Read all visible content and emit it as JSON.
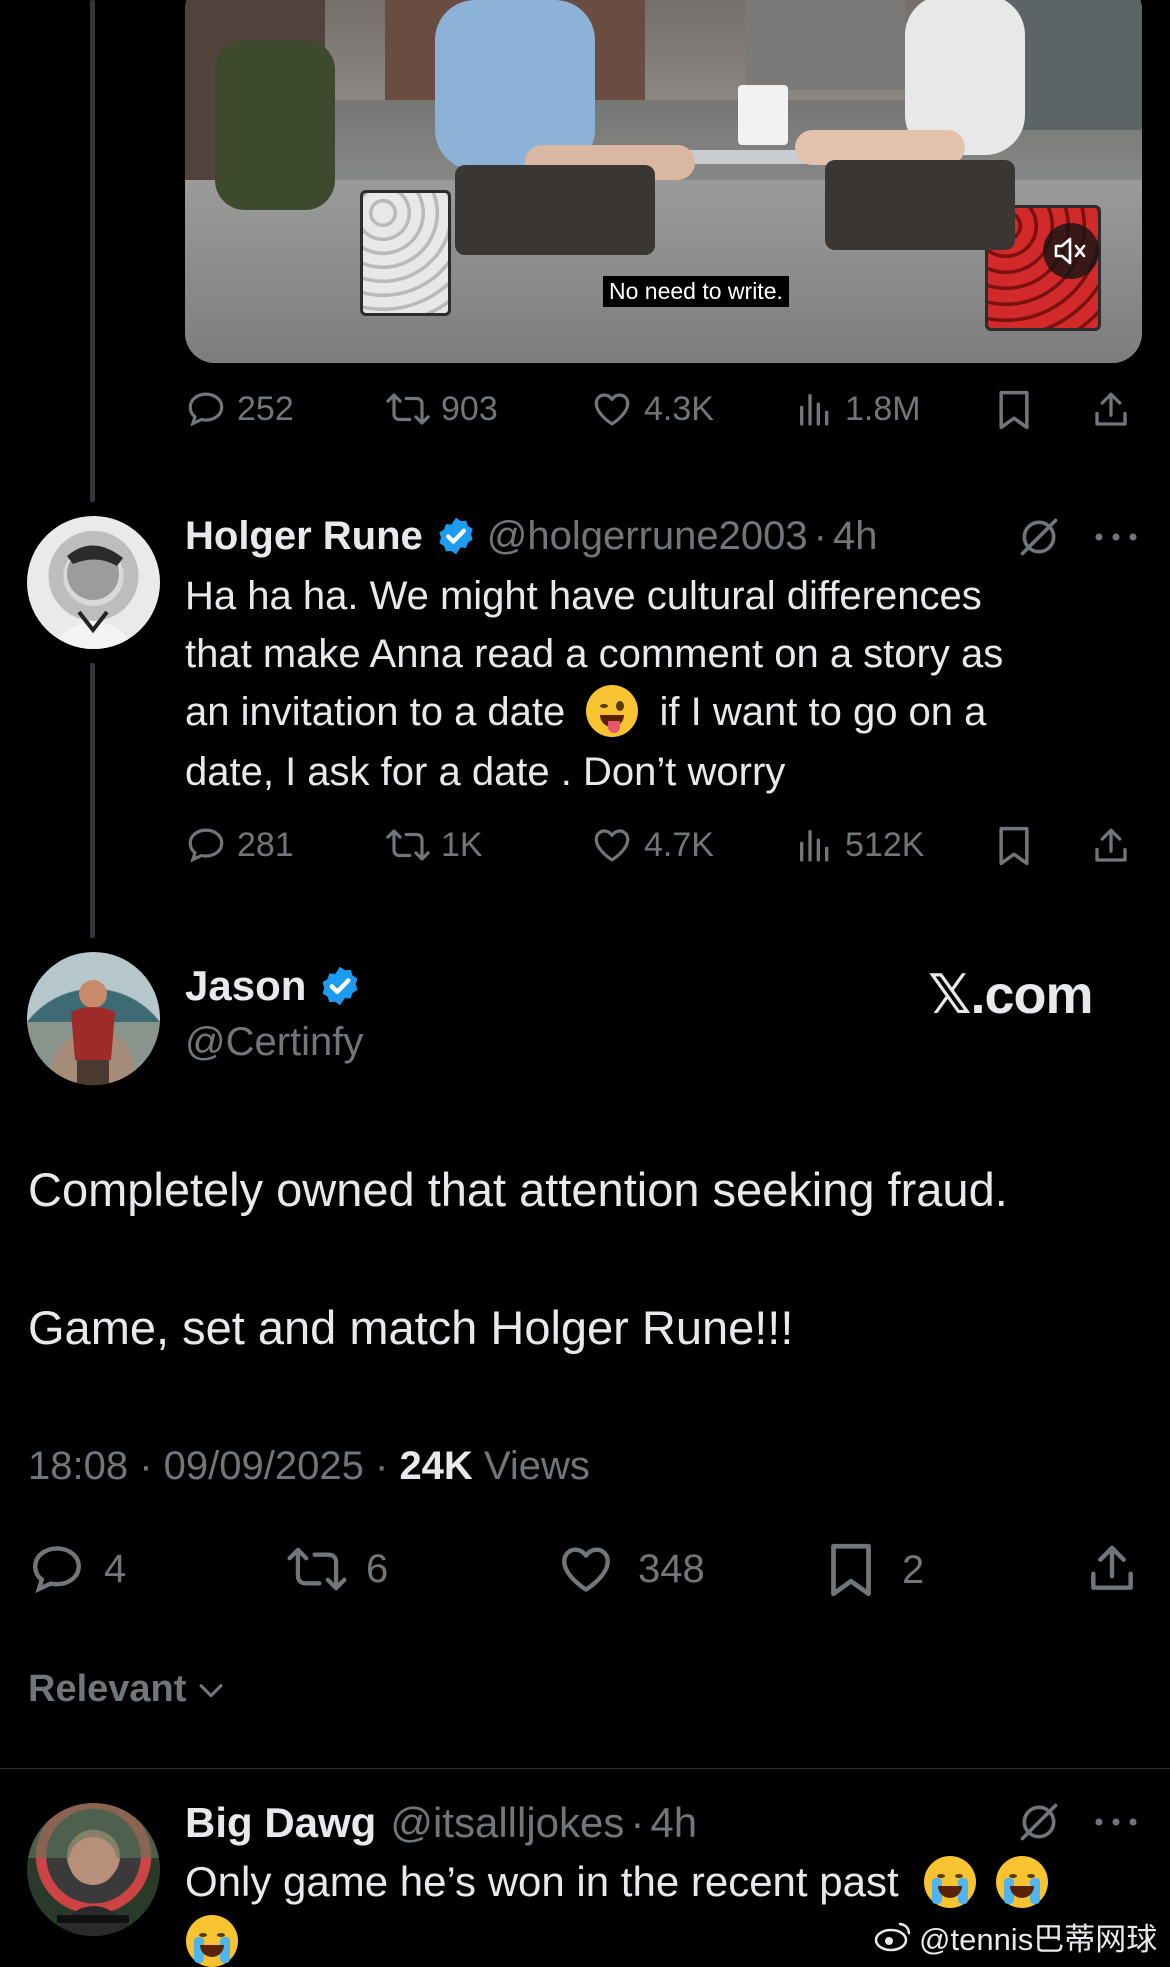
{
  "video": {
    "caption": "No need to write.",
    "mute_icon": "speaker-muted-icon"
  },
  "tweet1_stats": {
    "replies": "252",
    "reposts": "903",
    "likes": "4.3K",
    "views": "1.8M"
  },
  "reply": {
    "name": "Holger Rune",
    "handle": "@holgerrune2003",
    "time": "4h",
    "lines": [
      "Ha ha ha. We might have cultural differences",
      "that make Anna read a comment on a story as",
      "an invitation to a date",
      "if I want to go on a",
      "date, I ask for a date . Don’t worry"
    ],
    "stats": {
      "replies": "281",
      "reposts": "1K",
      "likes": "4.7K",
      "views": "512K"
    }
  },
  "main_tweet": {
    "name": "Jason",
    "handle": "@Certinfy",
    "source": "𝕏.com",
    "text1": "Completely owned that attention seeking fraud.",
    "text2": "Game, set and match Holger Rune!!!",
    "time": "18:08",
    "date": "09/09/2025",
    "views_count": "24K",
    "views_label": "Views",
    "stats": {
      "replies": "4",
      "reposts": "6",
      "likes": "348",
      "bookmarks": "2"
    }
  },
  "sort": {
    "label": "Relevant"
  },
  "comment": {
    "name": "Big Dawg",
    "handle": "@itsallljokes",
    "time": "4h",
    "text": "Only game he’s won in the recent past"
  },
  "watermark": "@tennis巴蒂网球",
  "colors": {
    "verified": "#1d9bf0",
    "muted_text": "#71767b",
    "text": "#e7e9ea",
    "background": "#000000"
  }
}
